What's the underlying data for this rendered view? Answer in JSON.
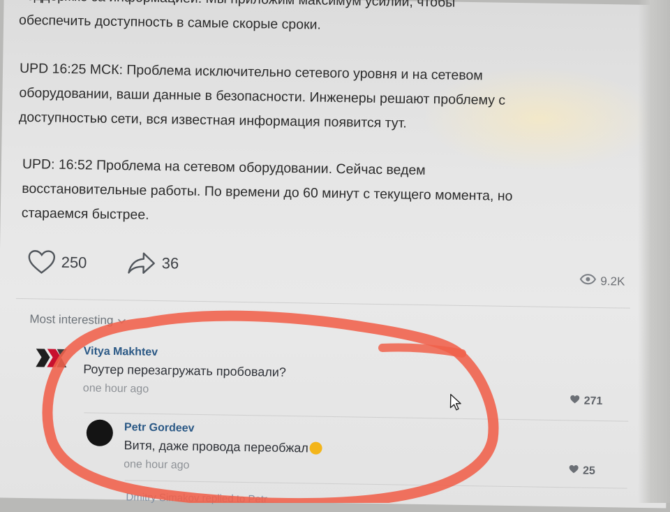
{
  "post": {
    "lines": [
      "поддержке за информацией. Мы приложим максимум усилий, чтобы",
      "обеспечить доступность в самые скорые сроки."
    ],
    "upd1_lines": [
      "UPD 16:25 МСК: Проблема исключительно сетевого уровня и на сетевом",
      "оборудовании, ваши данные в безопасности. Инженеры решают проблему с",
      "доступностью сети, вся известная информация появится тут."
    ],
    "upd2_lines": [
      "UPD: 16:52 Проблема на сетевом оборудовании. Сейчас ведем",
      "восстановительные работы. По времени до 60 минут с текущего момента, но",
      "стараемся быстрее."
    ]
  },
  "actions": {
    "likes": "250",
    "shares": "36",
    "views": "9.2K"
  },
  "comments_sort": {
    "label": "Most interesting"
  },
  "comments": [
    {
      "author": "Vitya Makhtev",
      "text": "Роутер перезагружать пробовали?",
      "time": "one hour ago",
      "likes": "271"
    },
    {
      "author": "Petr Gordeev",
      "text": "Витя, даже провода переобжал",
      "time": "one hour ago",
      "likes": "25"
    }
  ],
  "cut_reply": "Dmitry Simakov replied to Petr",
  "colors": {
    "author": "#2a5885",
    "text": "#2b2b2b",
    "meta": "#8d9196",
    "scribble": "#f0604a"
  }
}
